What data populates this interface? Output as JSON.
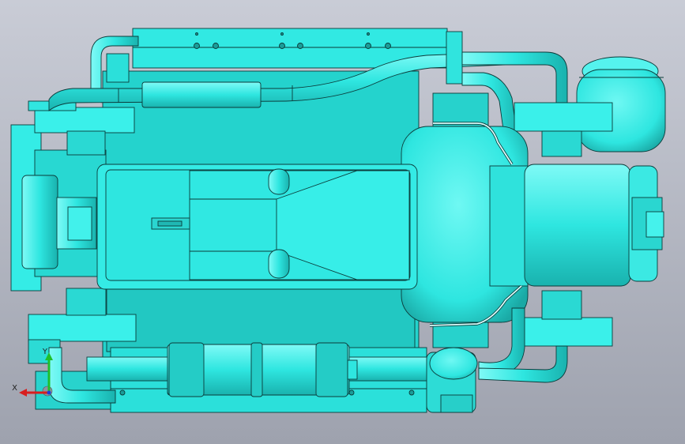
{
  "viewport": {
    "background_top": "#c9ccd6",
    "background_bottom": "#9ea2ae"
  },
  "model": {
    "fill_color": "#2ee6e0",
    "fill_light": "#5ff5f0",
    "fill_dark": "#1fb8b4",
    "edge_color": "#0b3b3a"
  },
  "triad": {
    "x_label": "X",
    "y_label": "Y",
    "x_color": "#d81e1e",
    "y_color": "#1fbf2a",
    "z_color": "#1e3cd8"
  }
}
